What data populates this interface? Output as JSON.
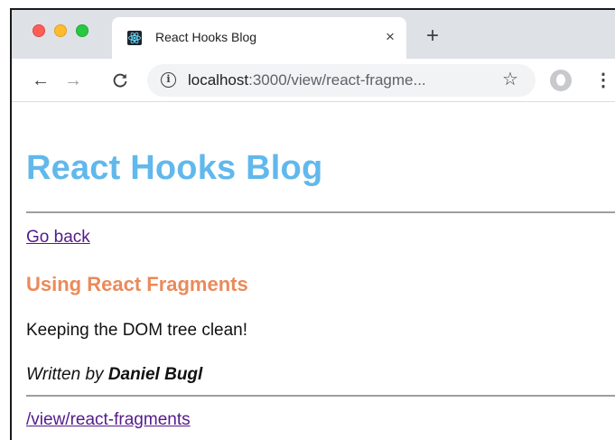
{
  "browser": {
    "tab": {
      "title": "React Hooks Blog",
      "favicon": "react-logo-icon",
      "close_glyph": "×"
    },
    "new_tab_glyph": "+",
    "nav": {
      "back_glyph": "←",
      "forward_glyph": "→",
      "reload_glyph": "C"
    },
    "address": {
      "info_glyph": "i",
      "host": "localhost",
      "rest": ":3000/view/react-fragme...",
      "star_glyph": "☆"
    },
    "menu_glyph": "⋮"
  },
  "page": {
    "site_title": "React Hooks Blog",
    "back_link": "Go back",
    "post": {
      "title": "Using React Fragments",
      "body": "Keeping the DOM tree clean!",
      "byline_prefix": "Written by",
      "author": "Daniel Bugl",
      "link": "/view/react-fragments"
    }
  },
  "colors": {
    "site_title": "#61b8ec",
    "post_title": "#ea8a5a",
    "link": "#551a8b"
  }
}
